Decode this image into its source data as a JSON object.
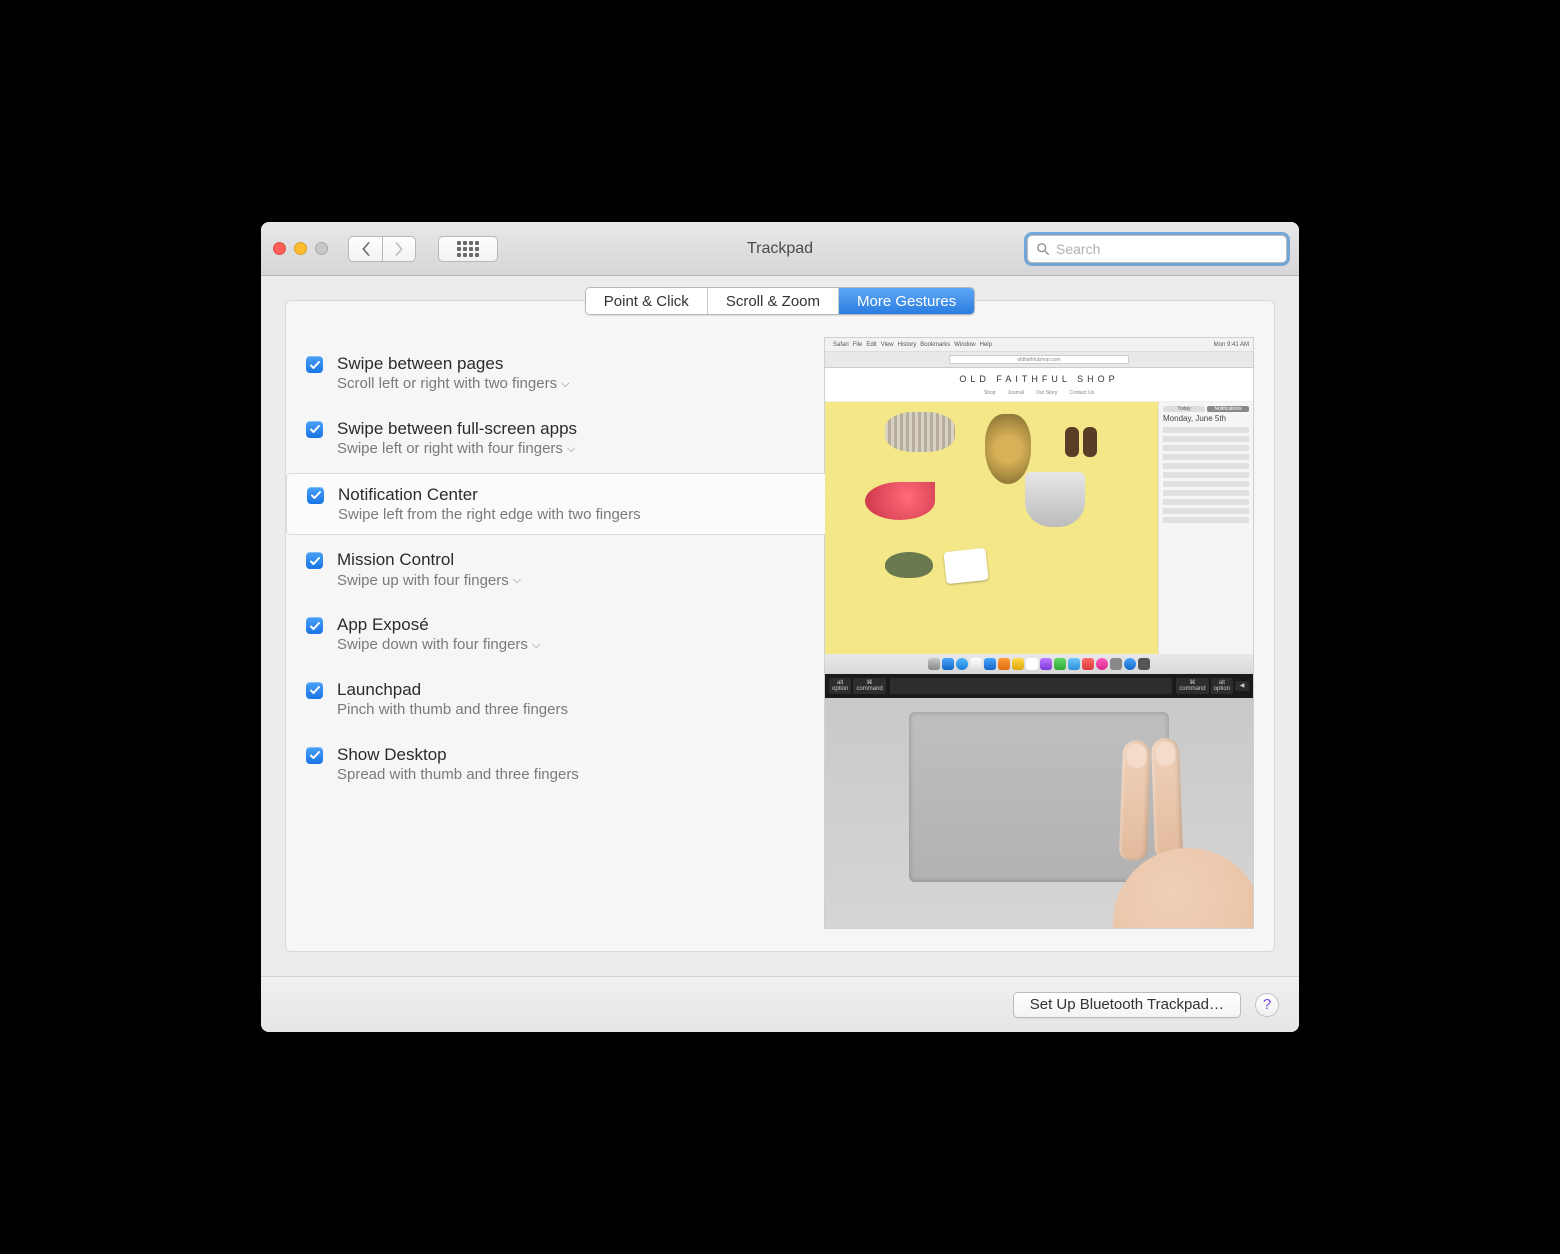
{
  "window": {
    "title": "Trackpad"
  },
  "search": {
    "placeholder": "Search",
    "value": ""
  },
  "tabs": [
    {
      "label": "Point & Click",
      "active": false
    },
    {
      "label": "Scroll & Zoom",
      "active": false
    },
    {
      "label": "More Gestures",
      "active": true
    }
  ],
  "gestures": [
    {
      "title": "Swipe between pages",
      "subtitle": "Scroll left or right with two fingers",
      "checked": true,
      "has_dropdown": true,
      "selected": false
    },
    {
      "title": "Swipe between full-screen apps",
      "subtitle": "Swipe left or right with four fingers",
      "checked": true,
      "has_dropdown": true,
      "selected": false
    },
    {
      "title": "Notification Center",
      "subtitle": "Swipe left from the right edge with two fingers",
      "checked": true,
      "has_dropdown": false,
      "selected": true
    },
    {
      "title": "Mission Control",
      "subtitle": "Swipe up with four fingers",
      "checked": true,
      "has_dropdown": true,
      "selected": false
    },
    {
      "title": "App Exposé",
      "subtitle": "Swipe down with four fingers",
      "checked": true,
      "has_dropdown": true,
      "selected": false
    },
    {
      "title": "Launchpad",
      "subtitle": "Pinch with thumb and three fingers",
      "checked": true,
      "has_dropdown": false,
      "selected": false
    },
    {
      "title": "Show Desktop",
      "subtitle": "Spread with thumb and three fingers",
      "checked": true,
      "has_dropdown": false,
      "selected": false
    }
  ],
  "preview": {
    "menubar": {
      "app": "Safari",
      "items": [
        "File",
        "Edit",
        "View",
        "History",
        "Bookmarks",
        "Window",
        "Help"
      ],
      "clock": "Mon 9:41 AM"
    },
    "url": "oldfaithfulshop.com",
    "logo": "OLD FAITHFUL SHOP",
    "nav": [
      "Shop",
      "Journal",
      "Our Story",
      "Contact Us"
    ],
    "sidebar_date": "Monday, June 5th",
    "toggle": {
      "left": "Today",
      "right": "Notifications"
    },
    "keys": {
      "alt": "alt",
      "option": "option",
      "command": "command",
      "cmd_sym": "⌘"
    }
  },
  "footer": {
    "bluetooth_button": "Set Up Bluetooth Trackpad…",
    "help": "?"
  }
}
